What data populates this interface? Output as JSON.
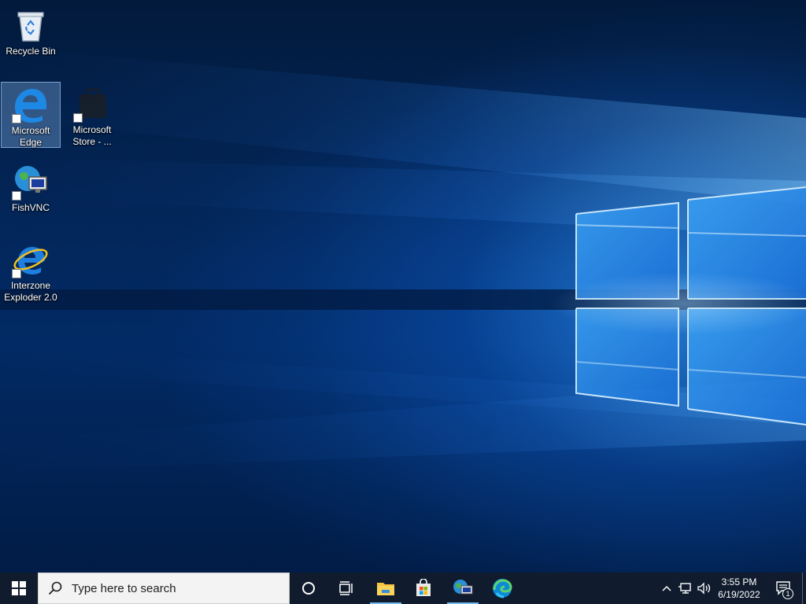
{
  "desktop": {
    "icons": [
      {
        "label": "Recycle Bin",
        "icon": "recycle-bin-icon",
        "selected": false
      },
      {
        "label": "Microsoft Edge",
        "icon": "edge-legacy-icon",
        "selected": true
      },
      {
        "label": "Microsoft Store - ...",
        "icon": "store-icon",
        "selected": false
      },
      {
        "label": "FishVNC",
        "icon": "globe-monitor-icon",
        "selected": false
      },
      {
        "label": "Interzone Exploder 2.0",
        "icon": "internet-explorer-icon",
        "selected": false
      }
    ]
  },
  "taskbar": {
    "search_placeholder": "Type here to search",
    "pinned_apps": [
      "file-explorer-icon",
      "store-bag-icon",
      "fishvnc-icon",
      "edge-icon"
    ],
    "running_apps": [
      "file-explorer",
      "fishvnc"
    ],
    "clock": {
      "time": "3:55 PM",
      "date": "6/19/2022"
    },
    "notification_count": "1"
  },
  "colors": {
    "taskbar_bg": "#101c2e",
    "search_bg": "#f3f3f3",
    "running_indicator": "#76b9ed",
    "selection": "#8cbef0"
  }
}
